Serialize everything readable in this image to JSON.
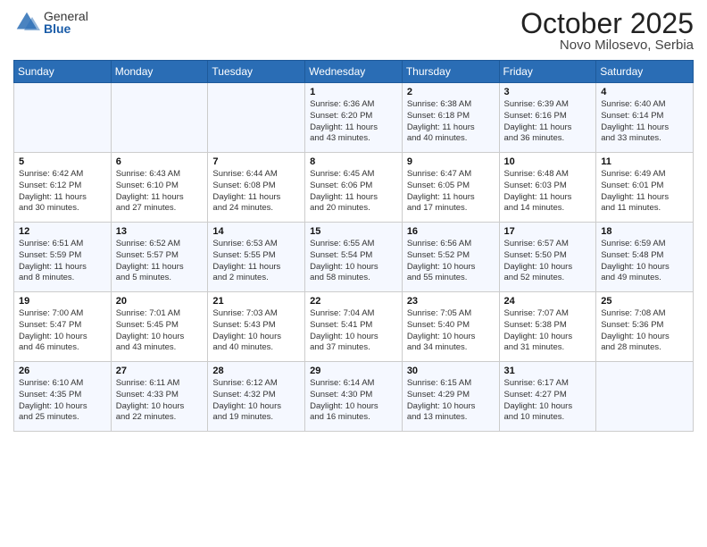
{
  "header": {
    "logo": {
      "general": "General",
      "blue": "Blue"
    },
    "title": "October 2025",
    "subtitle": "Novo Milosevo, Serbia"
  },
  "weekdays": [
    "Sunday",
    "Monday",
    "Tuesday",
    "Wednesday",
    "Thursday",
    "Friday",
    "Saturday"
  ],
  "weeks": [
    [
      {
        "day": "",
        "info": ""
      },
      {
        "day": "",
        "info": ""
      },
      {
        "day": "",
        "info": ""
      },
      {
        "day": "1",
        "info": "Sunrise: 6:36 AM\nSunset: 6:20 PM\nDaylight: 11 hours\nand 43 minutes."
      },
      {
        "day": "2",
        "info": "Sunrise: 6:38 AM\nSunset: 6:18 PM\nDaylight: 11 hours\nand 40 minutes."
      },
      {
        "day": "3",
        "info": "Sunrise: 6:39 AM\nSunset: 6:16 PM\nDaylight: 11 hours\nand 36 minutes."
      },
      {
        "day": "4",
        "info": "Sunrise: 6:40 AM\nSunset: 6:14 PM\nDaylight: 11 hours\nand 33 minutes."
      }
    ],
    [
      {
        "day": "5",
        "info": "Sunrise: 6:42 AM\nSunset: 6:12 PM\nDaylight: 11 hours\nand 30 minutes."
      },
      {
        "day": "6",
        "info": "Sunrise: 6:43 AM\nSunset: 6:10 PM\nDaylight: 11 hours\nand 27 minutes."
      },
      {
        "day": "7",
        "info": "Sunrise: 6:44 AM\nSunset: 6:08 PM\nDaylight: 11 hours\nand 24 minutes."
      },
      {
        "day": "8",
        "info": "Sunrise: 6:45 AM\nSunset: 6:06 PM\nDaylight: 11 hours\nand 20 minutes."
      },
      {
        "day": "9",
        "info": "Sunrise: 6:47 AM\nSunset: 6:05 PM\nDaylight: 11 hours\nand 17 minutes."
      },
      {
        "day": "10",
        "info": "Sunrise: 6:48 AM\nSunset: 6:03 PM\nDaylight: 11 hours\nand 14 minutes."
      },
      {
        "day": "11",
        "info": "Sunrise: 6:49 AM\nSunset: 6:01 PM\nDaylight: 11 hours\nand 11 minutes."
      }
    ],
    [
      {
        "day": "12",
        "info": "Sunrise: 6:51 AM\nSunset: 5:59 PM\nDaylight: 11 hours\nand 8 minutes."
      },
      {
        "day": "13",
        "info": "Sunrise: 6:52 AM\nSunset: 5:57 PM\nDaylight: 11 hours\nand 5 minutes."
      },
      {
        "day": "14",
        "info": "Sunrise: 6:53 AM\nSunset: 5:55 PM\nDaylight: 11 hours\nand 2 minutes."
      },
      {
        "day": "15",
        "info": "Sunrise: 6:55 AM\nSunset: 5:54 PM\nDaylight: 10 hours\nand 58 minutes."
      },
      {
        "day": "16",
        "info": "Sunrise: 6:56 AM\nSunset: 5:52 PM\nDaylight: 10 hours\nand 55 minutes."
      },
      {
        "day": "17",
        "info": "Sunrise: 6:57 AM\nSunset: 5:50 PM\nDaylight: 10 hours\nand 52 minutes."
      },
      {
        "day": "18",
        "info": "Sunrise: 6:59 AM\nSunset: 5:48 PM\nDaylight: 10 hours\nand 49 minutes."
      }
    ],
    [
      {
        "day": "19",
        "info": "Sunrise: 7:00 AM\nSunset: 5:47 PM\nDaylight: 10 hours\nand 46 minutes."
      },
      {
        "day": "20",
        "info": "Sunrise: 7:01 AM\nSunset: 5:45 PM\nDaylight: 10 hours\nand 43 minutes."
      },
      {
        "day": "21",
        "info": "Sunrise: 7:03 AM\nSunset: 5:43 PM\nDaylight: 10 hours\nand 40 minutes."
      },
      {
        "day": "22",
        "info": "Sunrise: 7:04 AM\nSunset: 5:41 PM\nDaylight: 10 hours\nand 37 minutes."
      },
      {
        "day": "23",
        "info": "Sunrise: 7:05 AM\nSunset: 5:40 PM\nDaylight: 10 hours\nand 34 minutes."
      },
      {
        "day": "24",
        "info": "Sunrise: 7:07 AM\nSunset: 5:38 PM\nDaylight: 10 hours\nand 31 minutes."
      },
      {
        "day": "25",
        "info": "Sunrise: 7:08 AM\nSunset: 5:36 PM\nDaylight: 10 hours\nand 28 minutes."
      }
    ],
    [
      {
        "day": "26",
        "info": "Sunrise: 6:10 AM\nSunset: 4:35 PM\nDaylight: 10 hours\nand 25 minutes."
      },
      {
        "day": "27",
        "info": "Sunrise: 6:11 AM\nSunset: 4:33 PM\nDaylight: 10 hours\nand 22 minutes."
      },
      {
        "day": "28",
        "info": "Sunrise: 6:12 AM\nSunset: 4:32 PM\nDaylight: 10 hours\nand 19 minutes."
      },
      {
        "day": "29",
        "info": "Sunrise: 6:14 AM\nSunset: 4:30 PM\nDaylight: 10 hours\nand 16 minutes."
      },
      {
        "day": "30",
        "info": "Sunrise: 6:15 AM\nSunset: 4:29 PM\nDaylight: 10 hours\nand 13 minutes."
      },
      {
        "day": "31",
        "info": "Sunrise: 6:17 AM\nSunset: 4:27 PM\nDaylight: 10 hours\nand 10 minutes."
      },
      {
        "day": "",
        "info": ""
      }
    ]
  ]
}
